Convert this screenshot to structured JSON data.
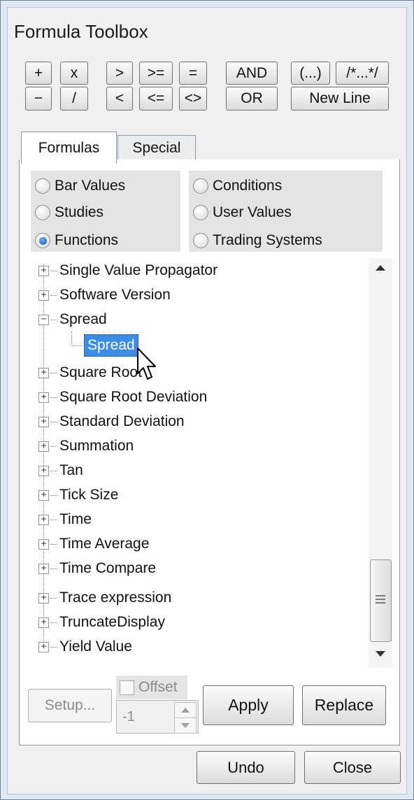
{
  "window": {
    "title": "Formula Toolbox"
  },
  "operators": {
    "row1": [
      "+",
      "x",
      ">",
      ">=",
      "=",
      "AND",
      "(...)",
      "/*...*/"
    ],
    "row2": [
      "−",
      "/",
      "<",
      "<=",
      "<>",
      "OR",
      "New Line"
    ]
  },
  "tabs": {
    "formulas": "Formulas",
    "special": "Special"
  },
  "categories": {
    "bar_values": "Bar Values",
    "conditions": "Conditions",
    "studies": "Studies",
    "user_values": "User Values",
    "functions": "Functions",
    "trading_systems": "Trading Systems",
    "selected": "Functions"
  },
  "tree": {
    "items": [
      "Single Value Propagator",
      "Software Version",
      "Spread",
      "Spread",
      "Square Root",
      "Square Root Deviation",
      "Standard Deviation",
      "Summation",
      "Tan",
      "Tick Size",
      "Time",
      "Time Average",
      "Time Compare",
      "Trace expression",
      "TruncateDisplay",
      "Yield Value"
    ]
  },
  "bottom": {
    "setup": "Setup...",
    "offset_label": "Offset",
    "offset_value": "-1",
    "apply": "Apply",
    "replace": "Replace",
    "undo": "Undo",
    "close": "Close"
  }
}
